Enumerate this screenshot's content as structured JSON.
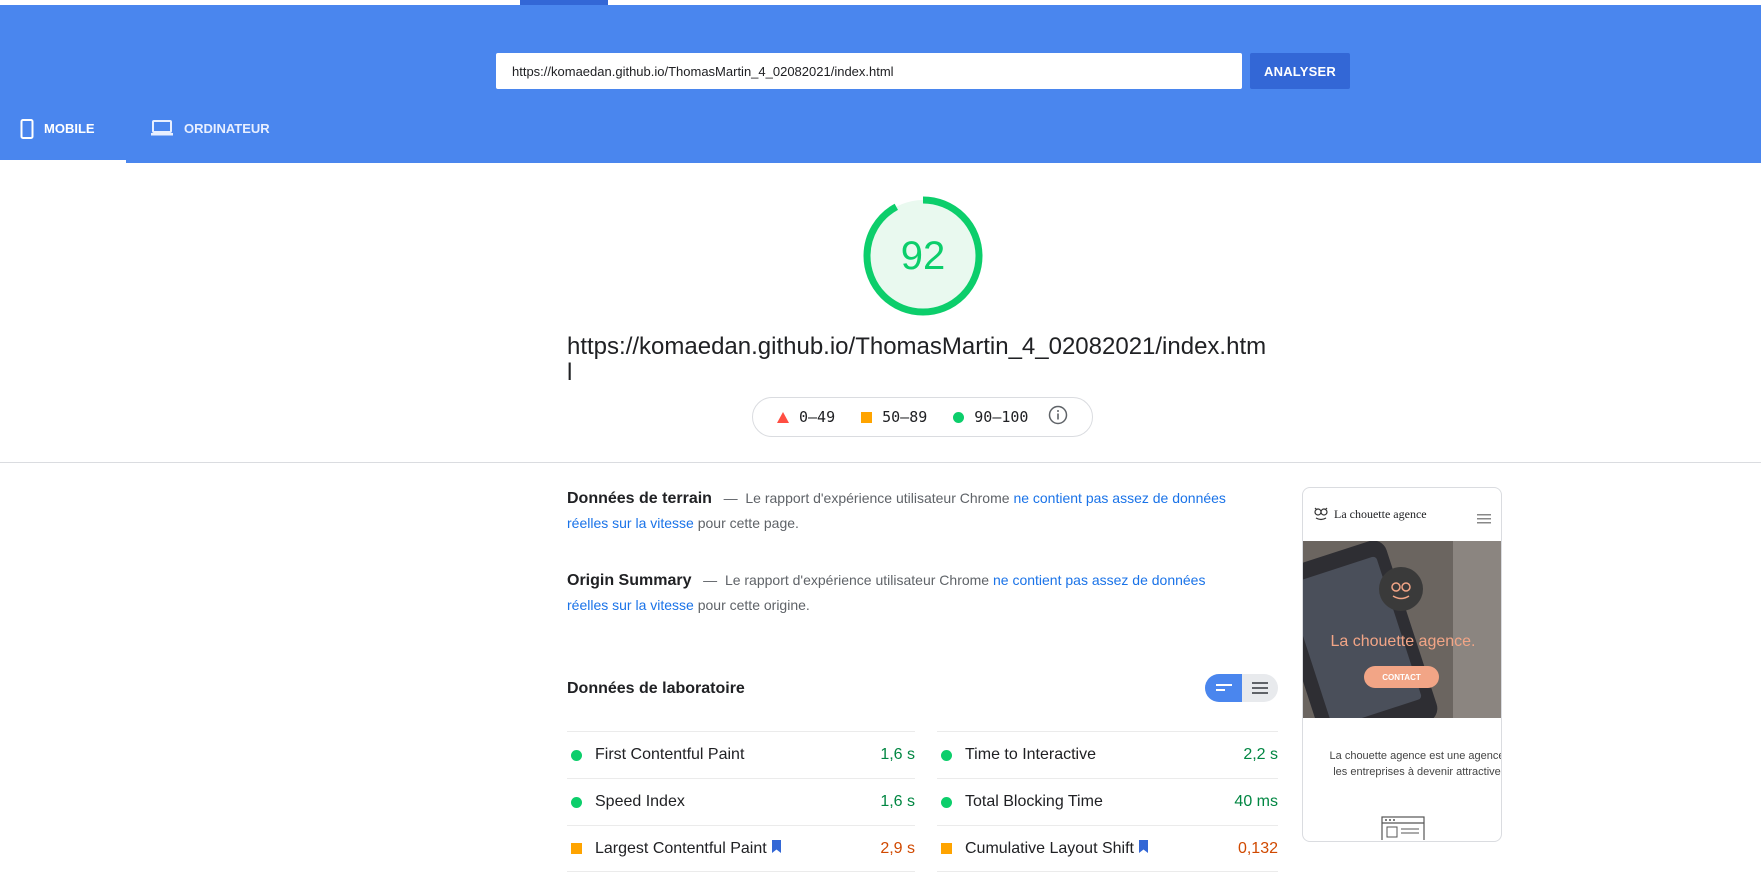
{
  "header": {
    "url_value": "https://komaedan.github.io/ThomasMartin_4_02082021/index.html",
    "analyse_label": "ANALYSER",
    "tabs": [
      {
        "label": "MOBILE",
        "icon": "smartphone-icon",
        "active": true
      },
      {
        "label": "ORDINATEUR",
        "icon": "laptop-icon",
        "active": false
      }
    ],
    "color": "#4a86ee"
  },
  "score": {
    "value": 92,
    "color": "#0cce6b",
    "page_url": "https://komaedan.github.io/ThomasMartin_4_02082021/index.html"
  },
  "legend": {
    "items": [
      {
        "range": "0–49",
        "shape": "triangle",
        "color": "#ff4e42"
      },
      {
        "range": "50–89",
        "shape": "square",
        "color": "#ffa400"
      },
      {
        "range": "90–100",
        "shape": "circle",
        "color": "#0cce6b"
      }
    ],
    "info_icon": "info-icon"
  },
  "field_data": {
    "title": "Données de terrain",
    "dash": "—",
    "text_before": "Le rapport d'expérience utilisateur Chrome",
    "link_text": "ne contient pas assez de données réelles sur la vitesse",
    "text_after": "pour cette page."
  },
  "origin_summary": {
    "title": "Origin Summary",
    "dash": "—",
    "text_before": "Le rapport d'expérience utilisateur Chrome",
    "link_text": "ne contient pas assez de données réelles sur la vitesse",
    "text_after": "pour cette origine."
  },
  "lab_data": {
    "title": "Données de laboratoire",
    "metrics_left": [
      {
        "name": "First Contentful Paint",
        "value": "1,6 s",
        "rating": "good",
        "bookmark": false
      },
      {
        "name": "Speed Index",
        "value": "1,6 s",
        "rating": "good",
        "bookmark": false
      },
      {
        "name": "Largest Contentful Paint",
        "value": "2,9 s",
        "rating": "average",
        "bookmark": true
      }
    ],
    "metrics_right": [
      {
        "name": "Time to Interactive",
        "value": "2,2 s",
        "rating": "good",
        "bookmark": false
      },
      {
        "name": "Total Blocking Time",
        "value": "40 ms",
        "rating": "good",
        "bookmark": false
      },
      {
        "name": "Cumulative Layout Shift",
        "value": "0,132",
        "rating": "average",
        "bookmark": true
      }
    ]
  },
  "screenshot_preview": {
    "site_name": "La chouette agence",
    "hero_title": "La chouette agence.",
    "hero_button": "CONTACT",
    "body_line1": "La chouette agence est une agence",
    "body_line2": "les entreprises à devenir attractive"
  }
}
